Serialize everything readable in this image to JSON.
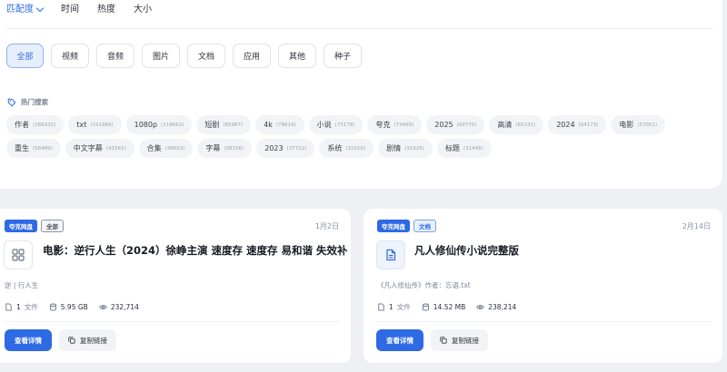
{
  "sort": {
    "items": [
      "匹配度",
      "时间",
      "热度",
      "大小"
    ],
    "active_index": 0
  },
  "types": [
    "全部",
    "视频",
    "音频",
    "图片",
    "文档",
    "应用",
    "其他",
    "种子"
  ],
  "hot": {
    "title": "热门搜索",
    "tags": [
      {
        "label": "作者",
        "count": "(266332)"
      },
      {
        "label": "txt",
        "count": "(151989)"
      },
      {
        "label": "1080p",
        "count": "(118662)"
      },
      {
        "label": "短剧",
        "count": "(85987)"
      },
      {
        "label": "4k",
        "count": "(78619)"
      },
      {
        "label": "小说",
        "count": "(75178)"
      },
      {
        "label": "夸克",
        "count": "(73469)"
      },
      {
        "label": "2025",
        "count": "(69770)"
      },
      {
        "label": "高清",
        "count": "(65231)"
      },
      {
        "label": "2024",
        "count": "(64173)"
      },
      {
        "label": "电影",
        "count": "(57051)"
      },
      {
        "label": "重生",
        "count": "(56489)"
      },
      {
        "label": "中文字幕",
        "count": "(41561)"
      },
      {
        "label": "合集",
        "count": "(39653)"
      },
      {
        "label": "字幕",
        "count": "(38336)"
      },
      {
        "label": "2023",
        "count": "(37722)"
      },
      {
        "label": "系统",
        "count": "(32016)"
      },
      {
        "label": "剧情",
        "count": "(31926)"
      },
      {
        "label": "标题",
        "count": "(31445)"
      }
    ]
  },
  "cards": [
    {
      "source": "夸克网盘",
      "type": "全部",
      "date": "1月2日",
      "icon": "grid-icon",
      "title": "电影：逆行人生（2024）徐峥主演 速度存 速度存 易和谐 失效补",
      "desc": "逆 | 行人生",
      "files": "1",
      "files_label": "文件",
      "size": "5.95 GB",
      "views": "232,714",
      "detail_label": "查看详情",
      "copy_label": "复制链接"
    },
    {
      "source": "夸克网盘",
      "type": "文档",
      "date": "2月14日",
      "icon": "document-icon",
      "title": "凡人修仙传小说完整版",
      "desc": "《凡人修仙传》作者：忘语.txt",
      "files": "1",
      "files_label": "文件",
      "size": "14.52 MB",
      "views": "238,214",
      "detail_label": "查看详情",
      "copy_label": "复制链接"
    }
  ],
  "colors": {
    "accent": "#2d6ae3",
    "background": "#eef0f4"
  }
}
